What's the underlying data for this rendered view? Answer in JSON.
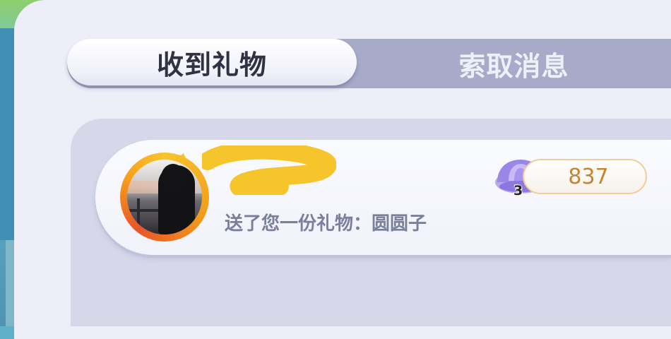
{
  "tabs": {
    "received_gifts": "收到礼物",
    "request_messages": "索取消息"
  },
  "gift_item": {
    "sender_name": "",
    "message": "送了您一份礼物：圆圆子",
    "shell_icon": "shell-icon",
    "shell_count": "3",
    "value": "837"
  },
  "colors": {
    "panel_bg": "#edeef8",
    "tab_bar": "#a7abc9",
    "value_text": "#c7842b",
    "value_border": "#f4cc97",
    "shell_purple": "#9a86e6",
    "avatar_ring": "#f39a1a"
  }
}
